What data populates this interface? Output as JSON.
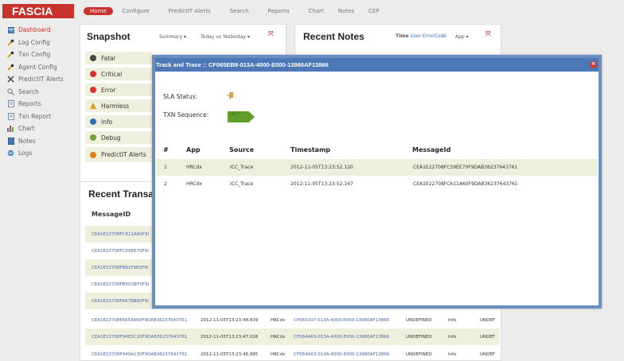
{
  "app": {
    "logo": "FASCIA"
  },
  "sidebar": {
    "items": [
      {
        "label": "Dashboard",
        "icon": "dashboard-icon",
        "active": true
      },
      {
        "label": "Log Config",
        "icon": "wrench-icon"
      },
      {
        "label": "Txn Config",
        "icon": "wrench-icon"
      },
      {
        "label": "Agent Config",
        "icon": "wrench-icon"
      },
      {
        "label": "PredictIT Alerts",
        "icon": "tools-icon"
      },
      {
        "label": "Search",
        "icon": "search-icon"
      },
      {
        "label": "Reports",
        "icon": "document-icon"
      },
      {
        "label": "Txn Report",
        "icon": "document-icon"
      },
      {
        "label": "Chart",
        "icon": "bar-chart-icon"
      },
      {
        "label": "Notes",
        "icon": "notes-icon"
      },
      {
        "label": "Logs",
        "icon": "logs-icon"
      }
    ]
  },
  "topnav": {
    "items": [
      "Home",
      "Configure",
      "PredictIT Alerts",
      "Search",
      "Reports",
      "Chart",
      "Notes",
      "CEP"
    ]
  },
  "snapshot": {
    "title": "Snapshot",
    "summary_label": "Summary",
    "range_label": "Today vs Yesterday",
    "rows": [
      {
        "label": "Fatal",
        "color": "#444444"
      },
      {
        "label": "Critical",
        "color": "#d9362b"
      },
      {
        "label": "Error",
        "color": "#d9362b"
      },
      {
        "label": "Harmless",
        "color": "#e69a1e"
      },
      {
        "label": "Info",
        "color": "#2f6fb7"
      },
      {
        "label": "Debug",
        "color": "#6aa33a"
      },
      {
        "label": "PredictIT Alerts",
        "color": "#e0801c"
      }
    ]
  },
  "notes": {
    "title": "Recent Notes",
    "time_label": "Time",
    "filter_user": "User",
    "filter_errorcode": "ErrorCode",
    "app_label": "App"
  },
  "transactions": {
    "title": "Recent Transa",
    "header_messageid": "MessageID",
    "partial_rows": [
      "CEA1E22708FC611A60F9(",
      "CEA1E22708FC59EE70F9(",
      "CEA1E22708FB61F9E0F9(",
      "CEA1E22708FB5D3EF0F9(",
      "CEA1E22708FA67BB60F9("
    ],
    "full_rows": [
      {
        "id": "CEA1E22708FA654A60F9DAB36237643761",
        "ts": "2012-11-05T13:23:48.839",
        "app": "HRCdx",
        "txn": "CF065107-013A-4000-E000-13980AF13866",
        "status": "UNDEFINED",
        "level": "Info",
        "extra": "UNDEF"
      },
      {
        "id": "CEA1E22708F94E5C20F9DAB36237643761",
        "ts": "2012-11-05T13:23:47.026",
        "app": "HRCdx",
        "txn": "CF064A63-013A-4000-E000-13980AF13866",
        "status": "UNDEFINED",
        "level": "Info",
        "extra": "UNDEF"
      },
      {
        "id": "CEA1E22708F949A130F9DAB36237643761",
        "ts": "2012-11-05T13:23:46.995",
        "app": "HRCdx",
        "txn": "CF064A63-013A-4000-E000-13980AF13866",
        "status": "UNDEFINED",
        "level": "Info",
        "extra": "UNDEF"
      }
    ]
  },
  "modal": {
    "title": "Track and Trace :: CF065EB8-013A-4000-E000-13980AF13866",
    "sla_label": "SLA Status:",
    "sequence_label": "TXN Sequence:",
    "sequence_node": "ICC_T",
    "headers": {
      "num": "#",
      "app": "App",
      "source": "Source",
      "timestamp": "Timestamp",
      "messageid": "MessageId"
    },
    "rows": [
      {
        "num": "1",
        "app": "HRCdx",
        "source": "ICC_Trace",
        "timestamp": "2012-11-05T13:23:52.120",
        "messageid": "CEA1E22708FC59EE70F9DAB36237643761"
      },
      {
        "num": "2",
        "app": "HRCdx",
        "source": "ICC_Trace",
        "timestamp": "2012-11-05T13:23:52.167",
        "messageid": "CEA1E22708FC611A60F9DAB36237643761"
      }
    ]
  }
}
